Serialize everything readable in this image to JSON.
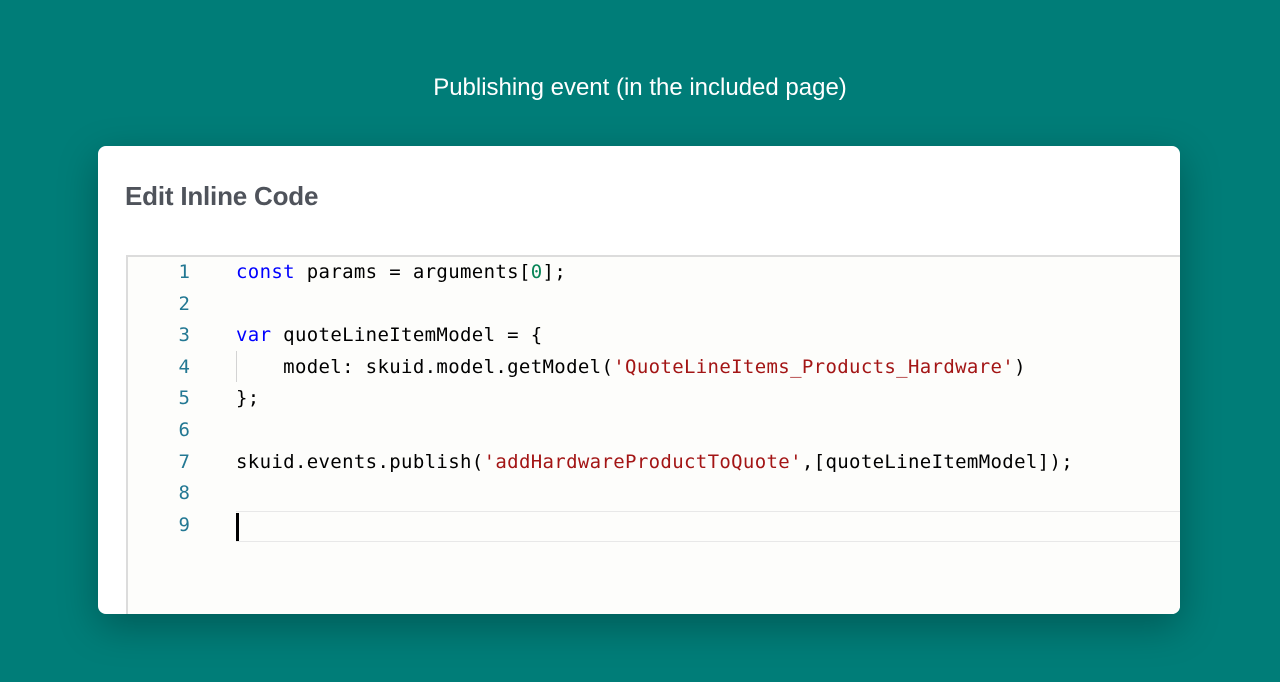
{
  "caption": "Publishing event (in the included page)",
  "dialog": {
    "title": "Edit Inline Code"
  },
  "editor": {
    "lines": [
      {
        "num": "1",
        "tokens": [
          {
            "t": "const",
            "k": "kw"
          },
          {
            "t": " params = arguments[",
            "k": "plain"
          },
          {
            "t": "0",
            "k": "numlit"
          },
          {
            "t": "];",
            "k": "plain"
          }
        ]
      },
      {
        "num": "2",
        "tokens": []
      },
      {
        "num": "3",
        "tokens": [
          {
            "t": "var",
            "k": "kw"
          },
          {
            "t": " quoteLineItemModel = {",
            "k": "plain"
          }
        ]
      },
      {
        "num": "4",
        "tokens": [
          {
            "t": "    model: skuid.model.getModel(",
            "k": "plain"
          },
          {
            "t": "'QuoteLineItems_Products_Hardware'",
            "k": "str"
          },
          {
            "t": ")",
            "k": "plain"
          }
        ]
      },
      {
        "num": "5",
        "tokens": [
          {
            "t": "};",
            "k": "plain"
          }
        ]
      },
      {
        "num": "6",
        "tokens": []
      },
      {
        "num": "7",
        "tokens": [
          {
            "t": "skuid.events.publish(",
            "k": "plain"
          },
          {
            "t": "'addHardwareProductToQuote'",
            "k": "str"
          },
          {
            "t": ",[quoteLineItemModel]);",
            "k": "plain"
          }
        ]
      },
      {
        "num": "8",
        "tokens": []
      },
      {
        "num": "9",
        "tokens": []
      }
    ]
  }
}
